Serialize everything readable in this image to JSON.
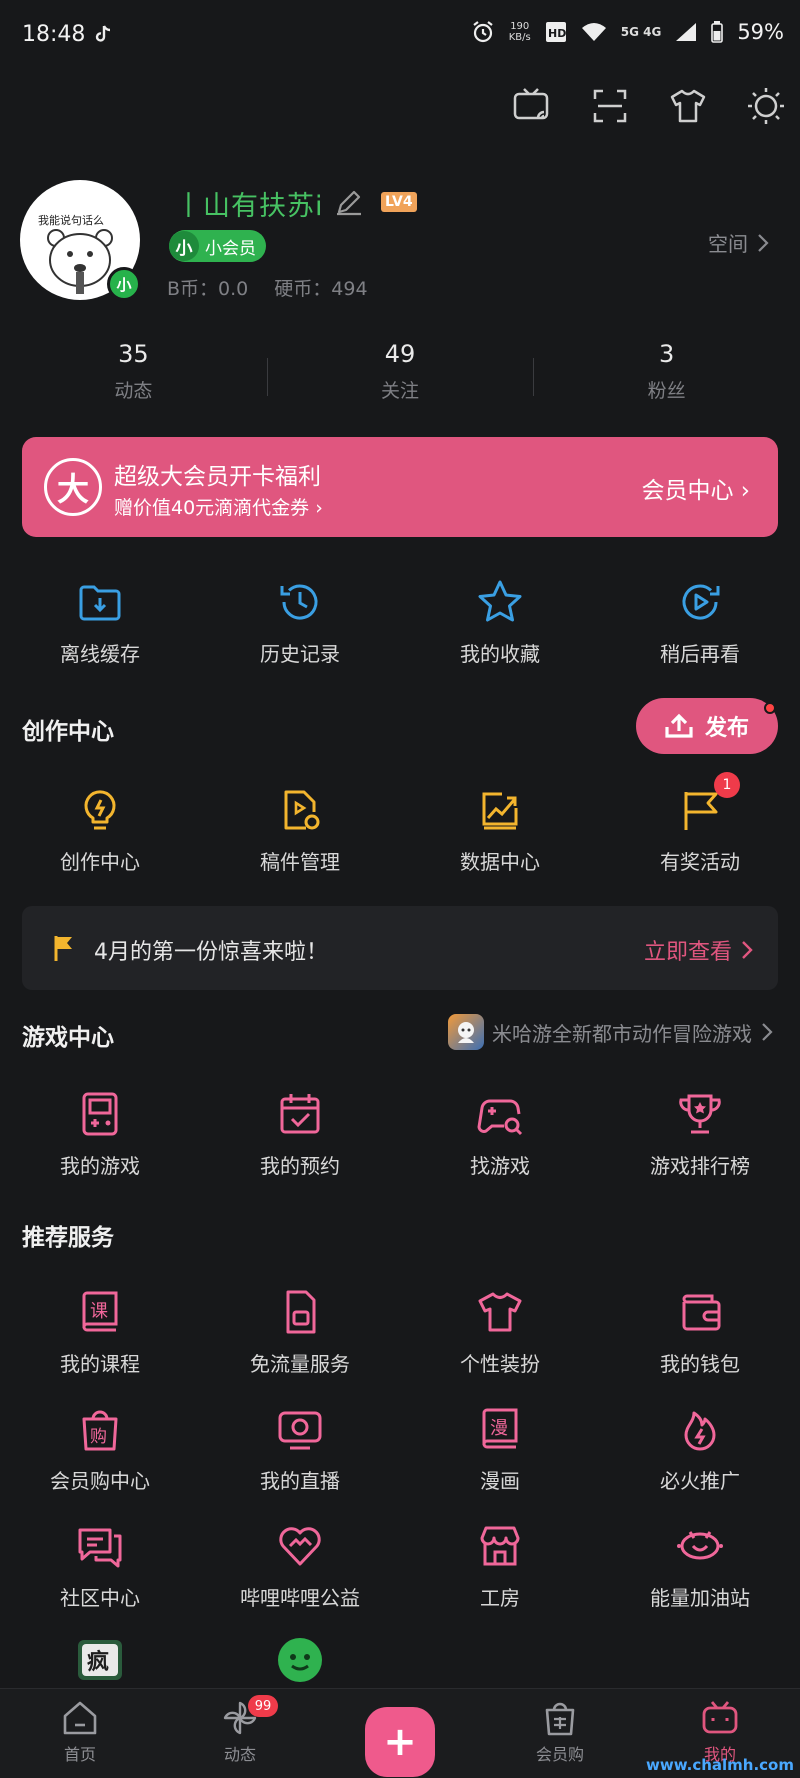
{
  "status_bar": {
    "time": "18:48",
    "net_speed": "190",
    "net_unit": "KB/s",
    "network": "5G 4G",
    "battery": "59%"
  },
  "profile": {
    "avatar_caption": "我能说句话么",
    "avatar_badge": "小",
    "username": "丨山有扶苏i",
    "level": "LV4",
    "vip_icon": "小",
    "vip_label": "小会员",
    "b_coins": "B币：0.0",
    "hard_coins": "硬币：494",
    "space_link": "空间"
  },
  "stats": [
    {
      "value": "35",
      "label": "动态"
    },
    {
      "value": "49",
      "label": "关注"
    },
    {
      "value": "3",
      "label": "粉丝"
    }
  ],
  "vip_banner": {
    "logo": "大",
    "title": "超级大会员开卡福利",
    "subtitle": "赠价值40元滴滴代金券",
    "cta": "会员中心"
  },
  "quick_actions": [
    {
      "label": "离线缓存",
      "icon": "download-folder-icon"
    },
    {
      "label": "历史记录",
      "icon": "history-clock-icon"
    },
    {
      "label": "我的收藏",
      "icon": "star-icon"
    },
    {
      "label": "稍后再看",
      "icon": "watch-later-icon"
    }
  ],
  "creator": {
    "title": "创作中心",
    "publish_label": "发布",
    "items": [
      {
        "label": "创作中心",
        "icon": "lightbulb-icon"
      },
      {
        "label": "稿件管理",
        "icon": "manuscript-icon"
      },
      {
        "label": "数据中心",
        "icon": "chart-trend-icon"
      },
      {
        "label": "有奖活动",
        "icon": "flag-icon",
        "badge": "1"
      }
    ]
  },
  "promo": {
    "text": "4月的第一份惊喜来啦！",
    "cta": "立即查看"
  },
  "game_center": {
    "title": "游戏中心",
    "promo_text": "米哈游全新都市动作冒险游戏",
    "items": [
      {
        "label": "我的游戏",
        "icon": "gameboy-icon"
      },
      {
        "label": "我的预约",
        "icon": "calendar-check-icon"
      },
      {
        "label": "找游戏",
        "icon": "gamepad-search-icon"
      },
      {
        "label": "游戏排行榜",
        "icon": "trophy-icon"
      }
    ]
  },
  "services": {
    "title": "推荐服务",
    "items": [
      {
        "label": "我的课程",
        "icon": "course-book-icon",
        "glyph": "课"
      },
      {
        "label": "免流量服务",
        "icon": "sim-card-icon"
      },
      {
        "label": "个性装扮",
        "icon": "tshirt-icon"
      },
      {
        "label": "我的钱包",
        "icon": "wallet-icon"
      },
      {
        "label": "会员购中心",
        "icon": "shopping-bag-icon",
        "glyph": "购"
      },
      {
        "label": "我的直播",
        "icon": "live-tv-icon"
      },
      {
        "label": "漫画",
        "icon": "comic-book-icon",
        "glyph": "漫"
      },
      {
        "label": "必火推广",
        "icon": "fire-icon"
      },
      {
        "label": "社区中心",
        "icon": "chat-bubbles-icon"
      },
      {
        "label": "哔哩哔哩公益",
        "icon": "heart-hands-icon"
      },
      {
        "label": "工房",
        "icon": "shop-icon"
      },
      {
        "label": "能量加油站",
        "icon": "energy-station-icon"
      }
    ],
    "partial_items": [
      {
        "glyph": "疯",
        "icon": "crazy-app-icon"
      },
      {
        "icon": "green-face-icon"
      }
    ]
  },
  "bottom_nav": {
    "items": [
      {
        "label": "首页",
        "icon": "home-icon"
      },
      {
        "label": "动态",
        "icon": "pinwheel-icon",
        "badge": "99"
      },
      {
        "label": "",
        "icon": "plus-icon",
        "glyph": "+"
      },
      {
        "label": "会员购",
        "icon": "shopping-bag-icon"
      },
      {
        "label": "我的",
        "icon": "bilibili-tv-icon"
      }
    ]
  },
  "watermark": "www.chalmh.com",
  "colors": {
    "background": "#17181a",
    "accent_pink": "#e0567f",
    "icon_blue": "#3a9fe3",
    "icon_yellow": "#f3b52e",
    "username_green": "#47c263"
  }
}
